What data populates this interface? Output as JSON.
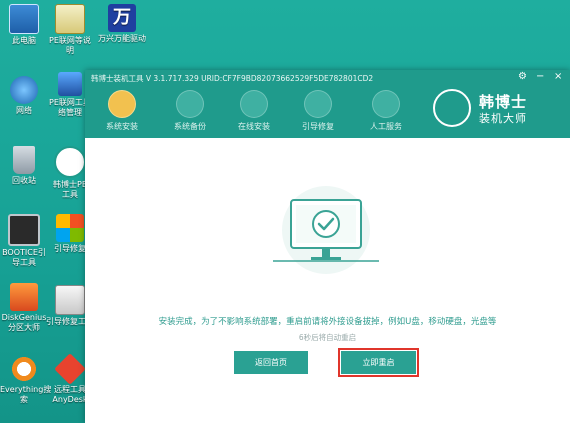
{
  "desktop": {
    "icons": [
      {
        "label": "此电脑",
        "icon": "computer-icon"
      },
      {
        "label": "PE联网等说明",
        "icon": "pe-doc-icon"
      },
      {
        "label": "万兴万能驱动",
        "icon": "wan-driver-icon"
      },
      {
        "label": "网络",
        "icon": "network-icon"
      },
      {
        "label": "PE联网工具\n络管理",
        "icon": "network-manager-icon"
      },
      {
        "label": "回收站",
        "icon": "recycle-bin-icon"
      },
      {
        "label": "韩博士PE\n工具",
        "icon": "hanboshi-icon"
      },
      {
        "label": "BOOTICE引\n导工具",
        "icon": "bootice-icon"
      },
      {
        "label": "引导修复",
        "icon": "boot-repair-icon"
      },
      {
        "label": "DiskGenius\n分区大师",
        "icon": "diskgenius-icon"
      },
      {
        "label": "引导修复工具",
        "icon": "boot-repair-tool-icon"
      },
      {
        "label": "Everything搜\n索",
        "icon": "everything-icon"
      },
      {
        "label": "远程工具\nAnyDesk",
        "icon": "anydesk-icon"
      }
    ]
  },
  "window": {
    "title": "韩博士装机工具 V 3.1.717.329 URID:CF7F9BD82073662529F5DE782801CD2",
    "tabs": [
      {
        "label": "系统安装",
        "icon": "install-icon"
      },
      {
        "label": "系统备份",
        "icon": "backup-icon"
      },
      {
        "label": "在线安装",
        "icon": "online-install-icon"
      },
      {
        "label": "引导修复",
        "icon": "repair-icon"
      },
      {
        "label": "人工服务",
        "icon": "service-icon"
      }
    ],
    "brand": {
      "line1": "韩博士",
      "line2": "装机大师"
    }
  },
  "main": {
    "message": "安装完成，为了不影响系统部署，重启前请将外接设备拔掉，例如U盘，移动硬盘，光盘等",
    "countdown": "6秒后将自动重启",
    "back_button": "返回首页",
    "restart_button": "立即重启"
  },
  "colors": {
    "accent": "#2aa193",
    "header": "#1f9b8c",
    "highlight": "#e0352b"
  }
}
